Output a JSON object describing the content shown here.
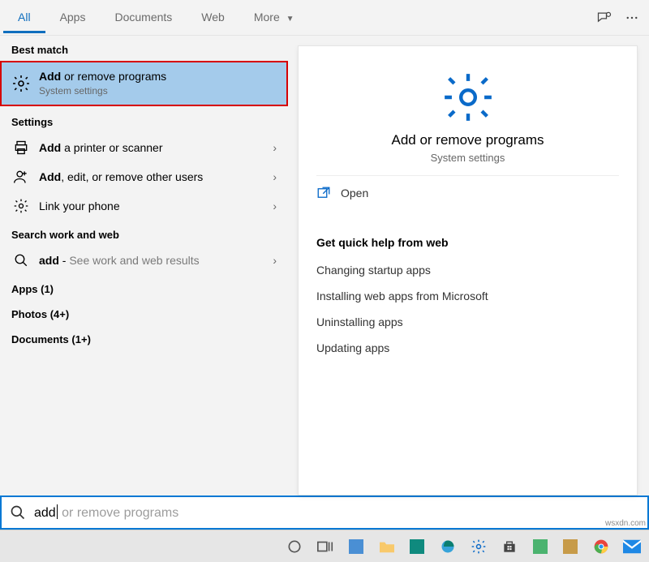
{
  "tabs": {
    "all": "All",
    "apps": "Apps",
    "documents": "Documents",
    "web": "Web",
    "more": "More"
  },
  "left": {
    "best_match": "Best match",
    "top": {
      "bold": "Add",
      "rest": " or remove programs",
      "sub": "System settings"
    },
    "settings": "Settings",
    "items": [
      {
        "bold": "Add",
        "rest": " a printer or scanner"
      },
      {
        "bold": "Add",
        "rest": ", edit, or remove other users"
      },
      {
        "plain": "Link your phone"
      }
    ],
    "search_web": "Search work and web",
    "web": {
      "bold": "add",
      "rest": " - ",
      "hint": "See work and web results"
    },
    "groups": [
      {
        "label": "Apps",
        "count": "(1)"
      },
      {
        "label": "Photos",
        "count": "(4+)"
      },
      {
        "label": "Documents",
        "count": "(1+)"
      }
    ]
  },
  "right": {
    "title": "Add or remove programs",
    "sub": "System settings",
    "open": "Open",
    "help_title": "Get quick help from web",
    "links": [
      "Changing startup apps",
      "Installing web apps from Microsoft",
      "Uninstalling apps",
      "Updating apps"
    ]
  },
  "search": {
    "typed": "add",
    "ghost": " or remove programs"
  },
  "watermark": "wsxdn.com"
}
